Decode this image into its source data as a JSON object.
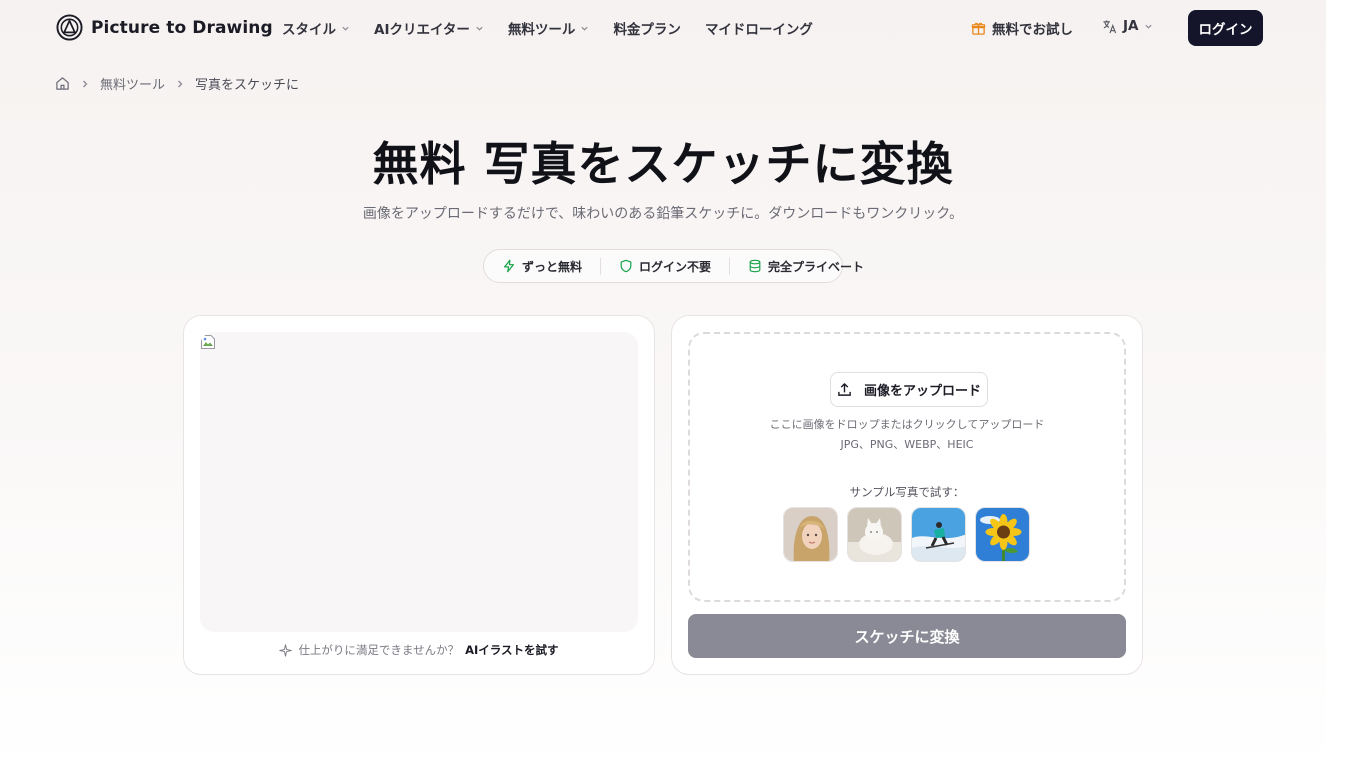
{
  "brand": {
    "name": "Picture to Drawing"
  },
  "nav": {
    "items": [
      {
        "label": "スタイル",
        "dropdown": true
      },
      {
        "label": "AIクリエイター",
        "dropdown": true
      },
      {
        "label": "無料ツール",
        "dropdown": true
      },
      {
        "label": "料金プラン",
        "dropdown": false
      },
      {
        "label": "マイドローイング",
        "dropdown": false
      }
    ],
    "trial_label": "無料でお試し",
    "language": "JA",
    "login_label": "ログイン"
  },
  "breadcrumb": {
    "items": [
      "無料ツール",
      "写真をスケッチに"
    ]
  },
  "hero": {
    "title": "無料 写真をスケッチに変換",
    "subtitle": "画像をアップロードするだけで、味わいのある鉛筆スケッチに。ダウンロードもワンクリック。",
    "badges": [
      {
        "label": "ずっと無料",
        "icon": "lightning-icon"
      },
      {
        "label": "ログイン不要",
        "icon": "shield-icon"
      },
      {
        "label": "完全プライベート",
        "icon": "database-icon"
      }
    ]
  },
  "preview": {
    "hint_text": "仕上がりに満足できませんか？",
    "hint_link": "AIイラストを試す"
  },
  "upload": {
    "button_label": "画像をアップロード",
    "drop_text": "ここに画像をドロップまたはクリックしてアップロード",
    "formats": "JPG、PNG、WEBP、HEIC",
    "sample_label": "サンプル写真で試す：",
    "convert_label": "スケッチに変換"
  },
  "colors": {
    "primary_dark": "#14142b",
    "accent_green": "#16a34a",
    "trial_orange": "#e8891a",
    "disabled_button": "#8a8a96"
  }
}
